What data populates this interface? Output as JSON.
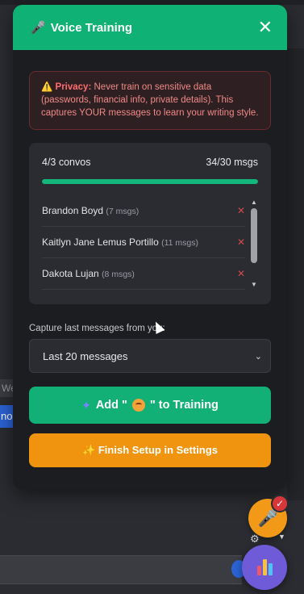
{
  "panel": {
    "title": "Voice Training",
    "title_icon": "🎤",
    "close_icon": "✕"
  },
  "privacy": {
    "icon": "⚠️",
    "label": "Privacy:",
    "text": " Never train on sensitive data (passwords, financial info, private details). This captures YOUR messages to learn your writing style."
  },
  "convos": {
    "convos_count": "4/3 convos",
    "msgs_count": "34/30 msgs",
    "progress_fraction": 1.0,
    "items": [
      {
        "name": "Brandon Boyd",
        "count": "(7 msgs)"
      },
      {
        "name": "Kaitlyn Jane Lemus Portillo",
        "count": "(11 msgs)"
      },
      {
        "name": "Dakota Lujan",
        "count": "(8 msgs)"
      }
    ],
    "remove_icon": "✕"
  },
  "capture": {
    "label": "Capture last messages from you:",
    "selected": "Last 20 messages"
  },
  "buttons": {
    "add_prefix": "Add \"",
    "add_suffix": "\" to Training",
    "finish": "✨ Finish Setup in Settings"
  },
  "background": {
    "chip1_text": "We h",
    "chip2_text": "no"
  },
  "fab": {
    "badge": "✓",
    "mic_icon": "🎤"
  },
  "colors": {
    "header_green": "#10b175",
    "progress_green": "#13b77b",
    "finish_orange": "#f09410",
    "stats_purple": "#6f5ad8"
  }
}
